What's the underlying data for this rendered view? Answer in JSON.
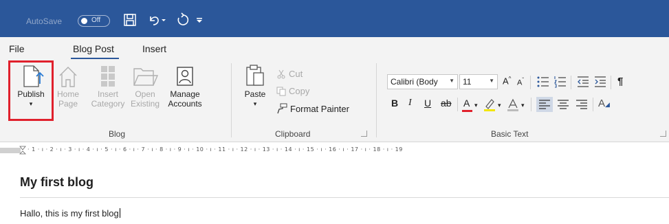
{
  "titlebar": {
    "autosave_label": "AutoSave",
    "autosave_state": "Off",
    "icons": [
      "save-icon",
      "undo-icon",
      "undo-dropdown-icon",
      "redo-icon",
      "customize-qat-icon"
    ]
  },
  "tabs": [
    {
      "label": "File",
      "active": false
    },
    {
      "label": "Blog Post",
      "active": true
    },
    {
      "label": "Insert",
      "active": false
    }
  ],
  "ribbon": {
    "blog": {
      "label": "Blog",
      "publish": {
        "line1": "Publish",
        "line2": "▾"
      },
      "home_page": {
        "line1": "Home",
        "line2": "Page"
      },
      "insert_category": {
        "line1": "Insert",
        "line2": "Category"
      },
      "open_existing": {
        "line1": "Open",
        "line2": "Existing"
      },
      "manage_accounts": {
        "line1": "Manage",
        "line2": "Accounts"
      }
    },
    "clipboard": {
      "label": "Clipboard",
      "paste": {
        "line1": "Paste",
        "line2": "▾"
      },
      "cut": "Cut",
      "copy": "Copy",
      "format_painter": "Format Painter"
    },
    "basic_text": {
      "label": "Basic Text",
      "font_name": "Calibri (Body",
      "font_size": "11",
      "grow": "A",
      "shrink": "A",
      "bold": "B",
      "italic": "I",
      "underline": "U",
      "strikethrough": "ab",
      "font_color_letter": "A",
      "paragraph_mark": "¶",
      "styles": "A",
      "font_color": "#e0202c",
      "highlight_color": "#f2e600"
    }
  },
  "ruler": {
    "text": "· 1 · ı · 2 · ı · 3 · ı · 4 · ı · 5 · ı · 6 · ı · 7 · ı · 8 · ı · 9 · ı · 10 · ı · 11 · ı · 12 · ı · 13 · ı · 14 · ı · 15 · ı · 16 · ı · 17 · ı · 18 · ı · 19"
  },
  "document": {
    "title": "My first blog",
    "body": "Hallo, this is my first blog"
  },
  "colors": {
    "titlebar": "#2b579a",
    "ribbon": "#f3f3f3",
    "highlight_box": "#e0202c"
  }
}
